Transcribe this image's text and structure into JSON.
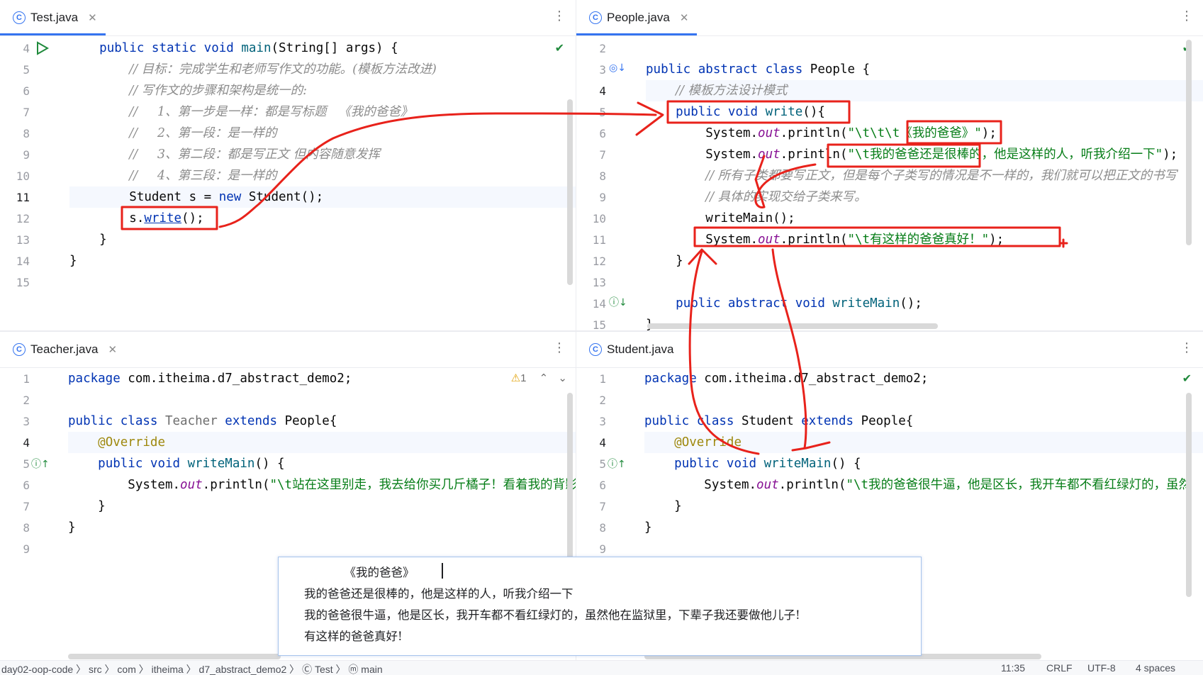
{
  "panes": {
    "test": {
      "tab": "Test.java",
      "lines": [
        {
          "n": "4",
          "html": "    <span class=\"kw\">public static void</span> <span class=\"fn\">main</span>(String[] args) {"
        },
        {
          "n": "5",
          "html": "        <span class=\"cm\">// 目标：完成学生和老师写作文的功能。(模板方法改进)</span>"
        },
        {
          "n": "6",
          "html": "        <span class=\"cm\">// 写作文的步骤和架构是统一的:</span>"
        },
        {
          "n": "7",
          "html": "        <span class=\"cm\">//     1、第一步是一样：都是写标题   《我的爸爸》</span>"
        },
        {
          "n": "8",
          "html": "        <span class=\"cm\">//     2、第一段：是一样的</span>"
        },
        {
          "n": "9",
          "html": "        <span class=\"cm\">//     3、第二段：都是写正文 但内容随意发挥</span>"
        },
        {
          "n": "10",
          "html": "        <span class=\"cm\">//     4、第三段：是一样的</span>"
        },
        {
          "n": "11",
          "html": "        Student s = <span class=\"kw\">new</span> Student();"
        },
        {
          "n": "12",
          "html": "        s.<span class=\"un\">write</span>();"
        },
        {
          "n": "13",
          "html": "    }"
        },
        {
          "n": "14",
          "html": "}"
        },
        {
          "n": "15",
          "html": ""
        }
      ]
    },
    "people": {
      "tab": "People.java",
      "lines": [
        {
          "n": "2",
          "html": ""
        },
        {
          "n": "3",
          "html": "<span class=\"kw\">public abstract class</span> People {"
        },
        {
          "n": "4",
          "html": "    <span class=\"cm\">// 模板方法设计模式</span>"
        },
        {
          "n": "5",
          "html": "    <span class=\"kw\">public void</span> <span class=\"fn\">write</span>(){"
        },
        {
          "n": "6",
          "html": "        System.<span class=\"it\">out</span>.println(<span class=\"st\">\"\\t\\t\\t《我的爸爸》\"</span>);"
        },
        {
          "n": "7",
          "html": "        System.<span class=\"it\">out</span>.println(<span class=\"st\">\"\\t我的爸爸还是很棒的，他是这样的人，听我介绍一下\"</span>);"
        },
        {
          "n": "8",
          "html": "        <span class=\"cm\">// 所有子类都要写正文，但是每个子类写的情况是不一样的，我们就可以把正文的书写</span>"
        },
        {
          "n": "9",
          "html": "        <span class=\"cm\">// 具体的实现交给子类来写。</span>"
        },
        {
          "n": "10",
          "html": "        writeMain();"
        },
        {
          "n": "11",
          "html": "        System.<span class=\"it\">out</span>.println(<span class=\"st\">\"\\t有这样的爸爸真好！\"</span>);"
        },
        {
          "n": "12",
          "html": "    }"
        },
        {
          "n": "13",
          "html": ""
        },
        {
          "n": "14",
          "html": "    <span class=\"kw\">public abstract void</span> <span class=\"fn\">writeMain</span>();"
        },
        {
          "n": "15",
          "html": "}"
        }
      ]
    },
    "teacher": {
      "tab": "Teacher.java",
      "warning": "1",
      "lines": [
        {
          "n": "1",
          "html": "<span class=\"kw\">package</span> com.itheima.d7_abstract_demo2;"
        },
        {
          "n": "2",
          "html": ""
        },
        {
          "n": "3",
          "html": "<span class=\"kw\">public class</span> <span class=\"gray\">Teacher</span> <span class=\"kw\">extends</span> People{"
        },
        {
          "n": "4",
          "html": "    <span class=\"an\">@Override</span>"
        },
        {
          "n": "5",
          "html": "    <span class=\"kw\">public void</span> <span class=\"fn\">writeMain</span>() {"
        },
        {
          "n": "6",
          "html": "        System.<span class=\"it\">out</span>.println(<span class=\"st\">\"\\t站在这里别走，我去给你买几斤橘子！看着我的背影</span>"
        },
        {
          "n": "7",
          "html": "    }"
        },
        {
          "n": "8",
          "html": "}"
        },
        {
          "n": "9",
          "html": ""
        }
      ]
    },
    "student": {
      "tab": "Student.java",
      "lines": [
        {
          "n": "1",
          "html": "<span class=\"kw\">package</span> com.itheima.d7_abstract_demo2;"
        },
        {
          "n": "2",
          "html": ""
        },
        {
          "n": "3",
          "html": "<span class=\"kw\">public class</span> Student <span class=\"kw\">extends</span> People{"
        },
        {
          "n": "4",
          "html": "    <span class=\"an\">@Override</span>"
        },
        {
          "n": "5",
          "html": "    <span class=\"kw\">public void</span> <span class=\"fn\">writeMain</span>() {"
        },
        {
          "n": "6",
          "html": "        System.<span class=\"it\">out</span>.println(<span class=\"st\">\"\\t我的爸爸很牛逼，他是区长，我开车都不看红绿灯的，虽然</span>"
        },
        {
          "n": "7",
          "html": "    }"
        },
        {
          "n": "8",
          "html": "}"
        },
        {
          "n": "9",
          "html": ""
        }
      ]
    }
  },
  "console": {
    "lines": [
      "          《我的爸爸》",
      "我的爸爸还是很棒的，他是这样的人，听我介绍一下",
      "我的爸爸很牛逼，他是区长，我开车都不看红绿灯的，虽然他在监狱里，下辈子我还要做他儿子!",
      "有这样的爸爸真好!"
    ]
  },
  "statusbar": {
    "path": "day02-oop-code  〉 src  〉 com  〉 itheima  〉 d7_abstract_demo2  〉 Ⓒ Test  〉 ⓜ main",
    "position": "11:35",
    "line_sep": "CRLF",
    "encoding": "UTF-8",
    "indent": "4 spaces"
  },
  "colors": {
    "annotation": "#e8221b",
    "accent": "#3574f0"
  }
}
